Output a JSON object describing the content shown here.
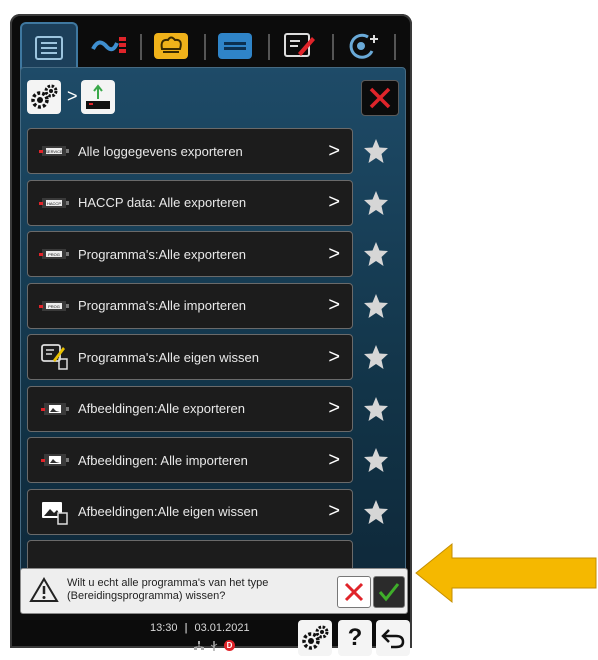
{
  "toolbar": {
    "tabs": [
      {
        "icon": "menu-lines-icon",
        "active": true
      },
      {
        "icon": "cooking-steps-icon",
        "active": false
      },
      {
        "icon": "chef-hat-icon",
        "active": false
      },
      {
        "icon": "tray-icon",
        "active": false
      },
      {
        "icon": "edit-icon",
        "active": false
      },
      {
        "icon": "clean-add-icon",
        "active": false
      }
    ]
  },
  "breadcrumb": {
    "items": [
      {
        "icon": "settings-gears-icon"
      },
      {
        "icon": "usb-export-icon"
      }
    ],
    "separator": ">"
  },
  "list": {
    "items": [
      {
        "label": "Alle loggegevens exporteren",
        "icon": "service-usb-icon",
        "icon_text": "SERVICE",
        "favorite": false
      },
      {
        "label": "HACCP data:  Alle exporteren",
        "icon": "haccp-usb-icon",
        "icon_text": "HACCP",
        "favorite": false
      },
      {
        "label": "Programma's:Alle exporteren",
        "icon": "prog-usb-icon",
        "icon_text": "PROG",
        "favorite": false
      },
      {
        "label": "Programma's:Alle importeren",
        "icon": "prog-usb-icon",
        "icon_text": "PROG",
        "favorite": false
      },
      {
        "label": "Programma's:Alle eigen wissen",
        "icon": "edit-delete-icon",
        "icon_text": "",
        "favorite": false
      },
      {
        "label": "Afbeeldingen:Alle exporteren",
        "icon": "image-usb-icon",
        "icon_text": "",
        "favorite": false
      },
      {
        "label": "Afbeeldingen: Alle importeren",
        "icon": "image-usb-icon",
        "icon_text": "",
        "favorite": false
      },
      {
        "label": "Afbeeldingen:Alle eigen wissen",
        "icon": "image-delete-icon",
        "icon_text": "",
        "favorite": false
      }
    ],
    "chevron": ">"
  },
  "dialog": {
    "line1": "Wilt u echt alle programma's van het type",
    "line2": "(Bereidingsprogramma) wissen?"
  },
  "statusbar": {
    "time": "13:30",
    "date": "03.01.2021",
    "badge": "D"
  },
  "buttons": {
    "help_label": "?"
  },
  "colors": {
    "panel": "#1e4b68",
    "accent_red": "#e0242a",
    "accent_green": "#3fae2a",
    "arrow": "#f5b800"
  }
}
